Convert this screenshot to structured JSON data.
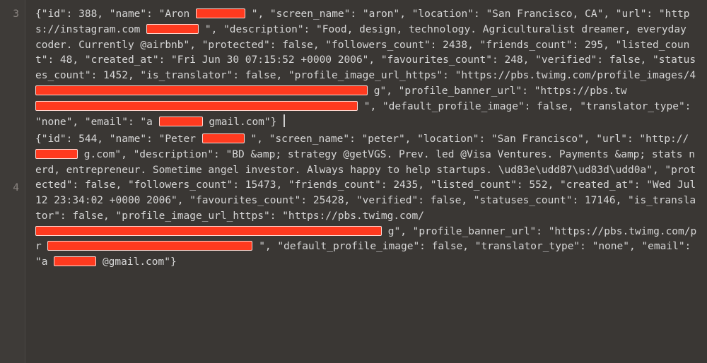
{
  "gutter": {
    "line3": "3",
    "line4": "4"
  },
  "line3": {
    "s01": "{\"id\": 388, \"name\": \"Aron ",
    "s02": "\", \"screen_name\": \"aron\", \"location\": \"San Francisco, CA\", \"url\": \"https://instagram.com",
    "s03": "\", \"description\": \"Food, design, technology. Agriculturalist dreamer, everyday coder. Currently @airbnb\", \"protected\": false, \"followers_count\": 2438, \"friends_count\": 295, \"listed_count\": 48, \"created_at\": \"Fri Jun 30 07:15:52 +0000 2006\", \"favourites_count\": 248, \"verified\": false, \"statuses_count\": 1452, \"is_translator\": false, \"profile_image_url_https\": \"https://pbs.twimg.com/profile_images/4",
    "s04": "g\", \"profile_banner_url\": \"https://pbs.tw",
    "s05": "\", \"default_profile_image\": false, \"translator_type\": \"none\", \"email\": \"a",
    "s06": "gmail.com\"}"
  },
  "line4": {
    "s01": "{\"id\": 544, \"name\": \"Peter ",
    "s02": "\", \"screen_name\": \"peter\", \"location\": \"San Francisco\", \"url\": \"http://",
    "s03": "g.com\", \"description\": \"BD &amp; strategy @getVGS. Prev. led @Visa Ventures. Payments &amp; stats nerd, entrepreneur. Sometime angel investor. Always happy to help startups. \\ud83e\\udd87\\ud83d\\udd0a\", \"protected\": false, \"followers_count\": 15473, \"friends_count\": 2435, \"listed_count\": 552, \"created_at\": \"Wed Jul 12 23:34:02 +0000 2006\", \"favourites_count\": 25428, \"verified\": false, \"statuses_count\": 17146, \"is_translator\": false, \"profile_image_url_https\": \"https://pbs.twimg.com/",
    "s04": "g\", \"profile_banner_url\": \"https://pbs.twimg.com/pr",
    "s05": "\", \"default_profile_image\": false, \"translator_type\": \"none\", \"email\": \"a",
    "s06": "@gmail.com\"}"
  }
}
